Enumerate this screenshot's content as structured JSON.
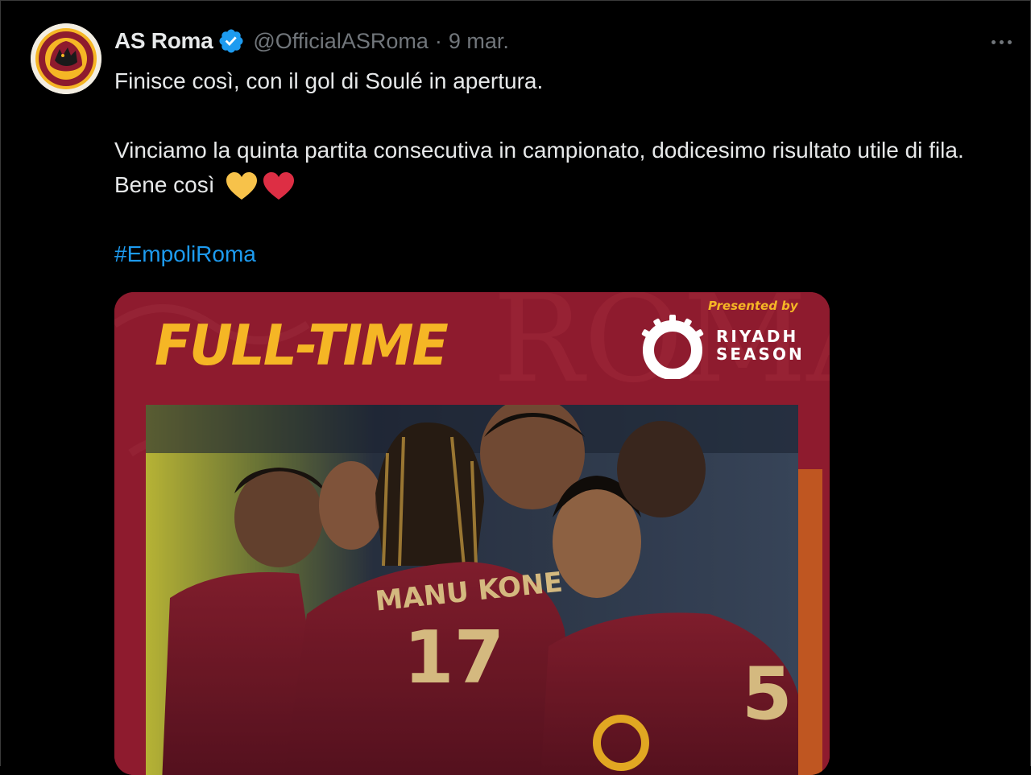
{
  "tweet": {
    "author": {
      "display_name": "AS Roma",
      "handle": "@OfficialASRoma",
      "verified": true,
      "avatar_icon": "as-roma-crest-icon"
    },
    "date": "9 mar.",
    "separator": "·",
    "text_line1": "Finisce così, con il gol di Soulé in apertura.",
    "text_line2": "Vinciamo la quinta partita consecutiva in campionato, dodicesimo risultato utile di fila. Bene così",
    "emojis": [
      "yellow-heart-icon",
      "red-heart-icon"
    ],
    "hashtag": "#EmpoliRoma",
    "more_icon": "more-options-icon"
  },
  "media": {
    "title": "FULL-TIME",
    "presented_by": "Presented by",
    "sponsor_line1": "RIYADH",
    "sponsor_line2": "SEASON",
    "background_letters": "ROMA",
    "jersey_name": "MANU KONE",
    "jersey_number": "17",
    "jersey_number_right": "5",
    "colors": {
      "roma_red": "#8e1b2e",
      "roma_gold": "#f5b625",
      "link_blue": "#1d9bf0",
      "muted_grey": "#71767b"
    }
  }
}
